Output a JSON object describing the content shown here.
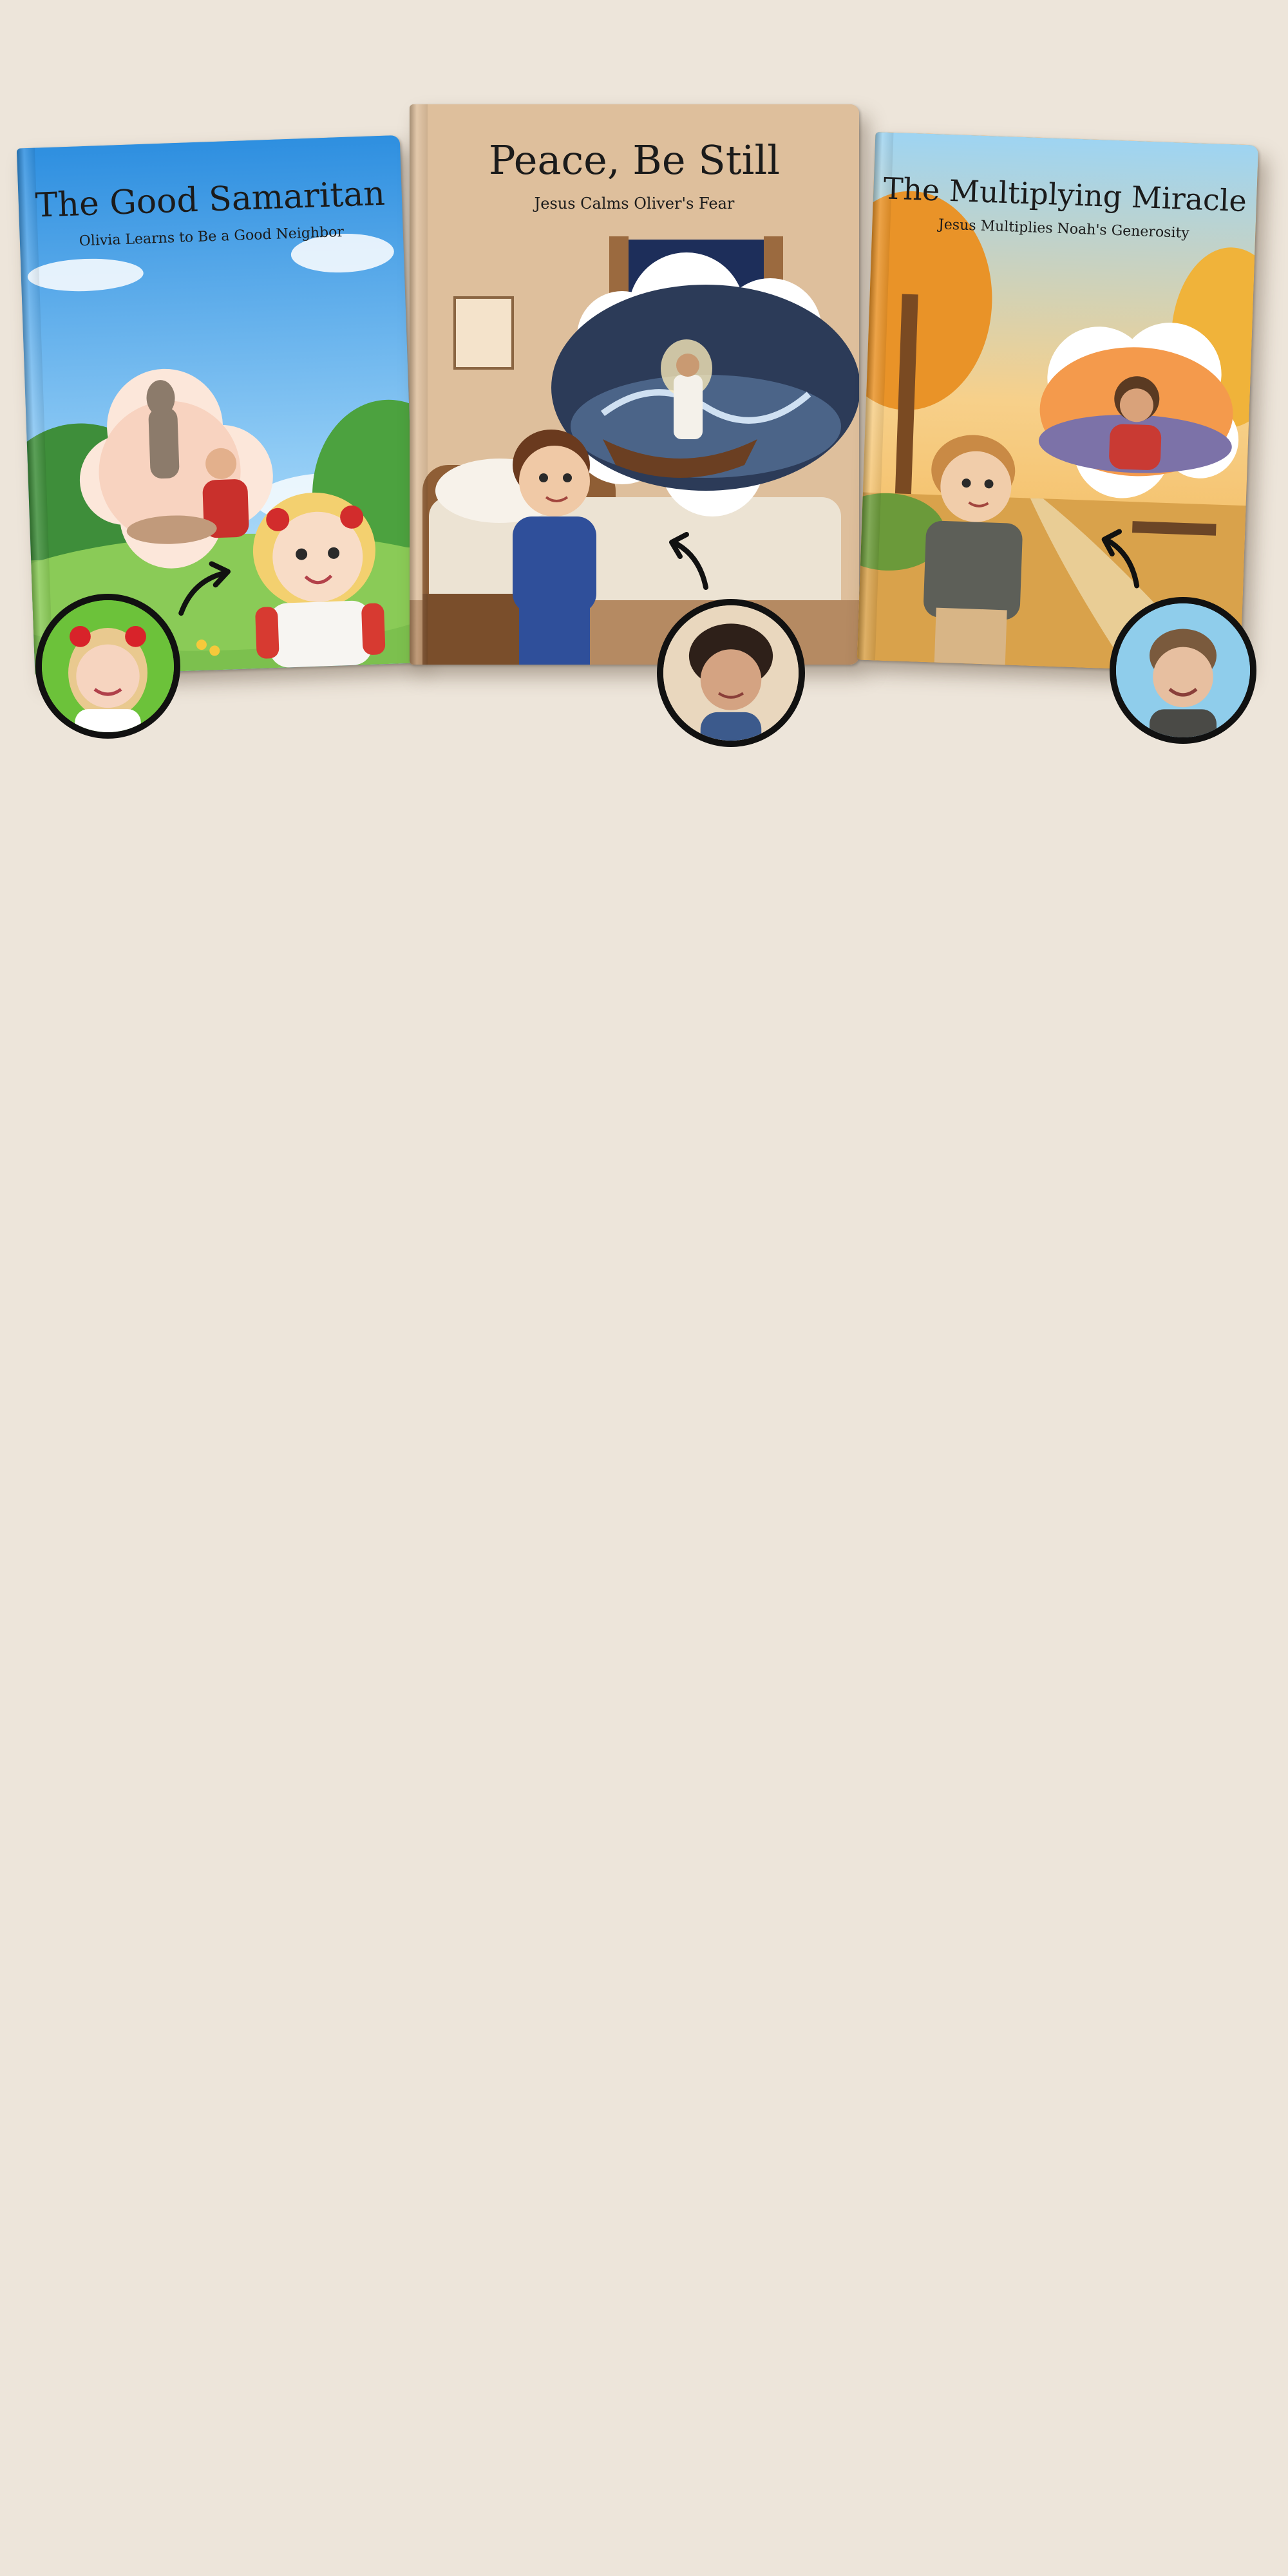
{
  "books": [
    {
      "title": "The Good Samaritan",
      "subtitle": "Olivia Learns to Be a Good Neighbor",
      "avatar_icon": "girl-with-red-bows-photo"
    },
    {
      "title": "Peace, Be Still",
      "subtitle": "Jesus Calms Oliver's Fear",
      "avatar_icon": "boy-with-curly-hair-photo"
    },
    {
      "title": "The Multiplying Miracle",
      "subtitle": "Jesus Multiplies Noah's Generosity",
      "avatar_icon": "smiling-toddler-photo"
    }
  ],
  "colors": {
    "background": "#EDE5DA",
    "book1_sky": "#3FA2EA",
    "book2_paper": "#D9B894",
    "book3_autumn": "#F2A23A"
  }
}
